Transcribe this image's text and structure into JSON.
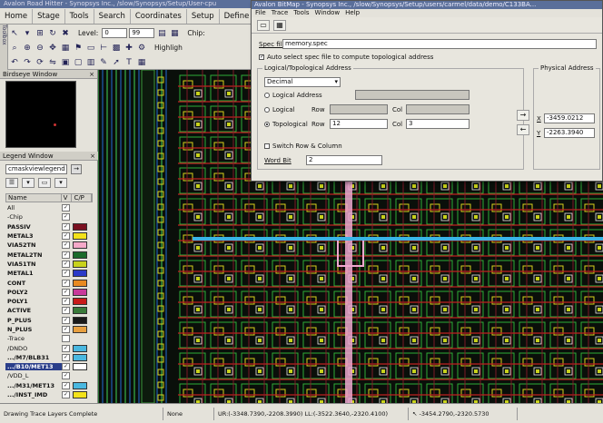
{
  "main_window": {
    "title": "Avalon Road Hitter - Synopsys Inc., /slow/Synopsys/Setup/User-cpu",
    "menu_tabs": [
      "Home",
      "Stage",
      "Tools",
      "Search",
      "Coordinates",
      "Setup",
      "Define"
    ]
  },
  "toolbar": {
    "level_label": "Level:",
    "level_from": "0",
    "level_to": "99",
    "chip_label": "Chip:",
    "highlight_label": "Highligh",
    "side_label": "Toolbox"
  },
  "birdseye": {
    "title": "Birdseye Window"
  },
  "legend": {
    "title": "Legend Window",
    "selected_legend": "cmaskviewlegend",
    "go_label": "→",
    "columns": [
      "Name",
      "V",
      "C/P"
    ],
    "rows": [
      {
        "name": "All",
        "group": true,
        "check": "✓",
        "color": ""
      },
      {
        "name": "-Chip",
        "group": true,
        "check": "✓",
        "color": ""
      },
      {
        "name": "PASSIV",
        "group": false,
        "check": "✓",
        "color": "#7a1020"
      },
      {
        "name": "METAL3",
        "group": false,
        "check": "✓",
        "color": "#f3e21a"
      },
      {
        "name": "VIA52TN",
        "group": false,
        "check": "✓",
        "color": "#f5a9c8"
      },
      {
        "name": "METAL2TN",
        "group": false,
        "check": "✓",
        "color": "#1b6a2a"
      },
      {
        "name": "VIA51TN",
        "group": false,
        "check": "✓",
        "color": "#c8d21c"
      },
      {
        "name": "METAL1",
        "group": false,
        "check": "✓",
        "color": "#2a3ac8"
      },
      {
        "name": "CONT",
        "group": false,
        "check": "✓",
        "color": "#e88a20"
      },
      {
        "name": "POLY2",
        "group": false,
        "check": "✓",
        "color": "#c83a9a"
      },
      {
        "name": "POLY1",
        "group": false,
        "check": "✓",
        "color": "#c81a1a"
      },
      {
        "name": "ACTIVE",
        "group": false,
        "check": "✓",
        "color": "#3a7a3a"
      },
      {
        "name": "P_PLUS",
        "group": false,
        "check": "✓",
        "color": "#1a1a1a"
      },
      {
        "name": "N_PLUS",
        "group": false,
        "check": "✓",
        "color": "#e8a040"
      },
      {
        "name": "-Trace",
        "group": true,
        "check": "",
        "color": ""
      },
      {
        "name": "/DNDO",
        "group": true,
        "check": "✓",
        "color": "#4ab8e0"
      },
      {
        "name": ".../M7/BLB31",
        "group": false,
        "check": "✓",
        "color": "#4ab8e0"
      },
      {
        "name": ".../B10/MET13",
        "group": false,
        "check": "✓",
        "color": "#ffffff",
        "selected": true
      },
      {
        "name": "/VDD_L",
        "group": true,
        "check": "✓",
        "color": ""
      },
      {
        "name": ".../M31/MET13",
        "group": false,
        "check": "✓",
        "color": "#4ab8e0"
      },
      {
        "name": ".../INST_IMD",
        "group": false,
        "check": "✓",
        "color": "#f3e21a"
      }
    ]
  },
  "dialog": {
    "title": "Avalon BitMap - Synopsys Inc., /slow/Synopsys/Setup/users/carmel/data/demo/C133BA...",
    "menu": [
      "File",
      "Trace",
      "Tools",
      "Window",
      "Help"
    ],
    "spec_file_label": "Spec file",
    "spec_file_value": "memory.spec",
    "auto_select_label": "Auto select spec file to compute topological address",
    "logical_group_title": "Logical/Topological Address",
    "radix_value": "Decimal",
    "logical_address_label": "Logical Address",
    "logical_label": "Logical",
    "topological_label": "Topological",
    "row_label": "Row",
    "col_label": "Col",
    "topo_row_value": "12",
    "topo_col_value": "3",
    "switch_label": "Switch Row & Column",
    "word_bit_label": "Word Bit",
    "word_bit_value": "2",
    "physical_group_title": "Physical Address",
    "x_label": "X",
    "y_label": "Y",
    "x_value": "-3459.0212",
    "y_value": "-2263.3940"
  },
  "statusbar": {
    "message": "Drawing Trace Layers Complete",
    "mode": "None",
    "coords": "UR:(-3348.7390,-2208.3990) LL:(-3522.3640,-2320.4100)",
    "cursor": "↖ -3454.2790,-2320.5730"
  },
  "colors": {
    "canvas_bg": "#0a0f0a",
    "trace_cyan": "#3ab4e6",
    "highlight_pink": "#f0a8d0",
    "metal_red": "#c02020",
    "active_green": "#2fae38"
  }
}
